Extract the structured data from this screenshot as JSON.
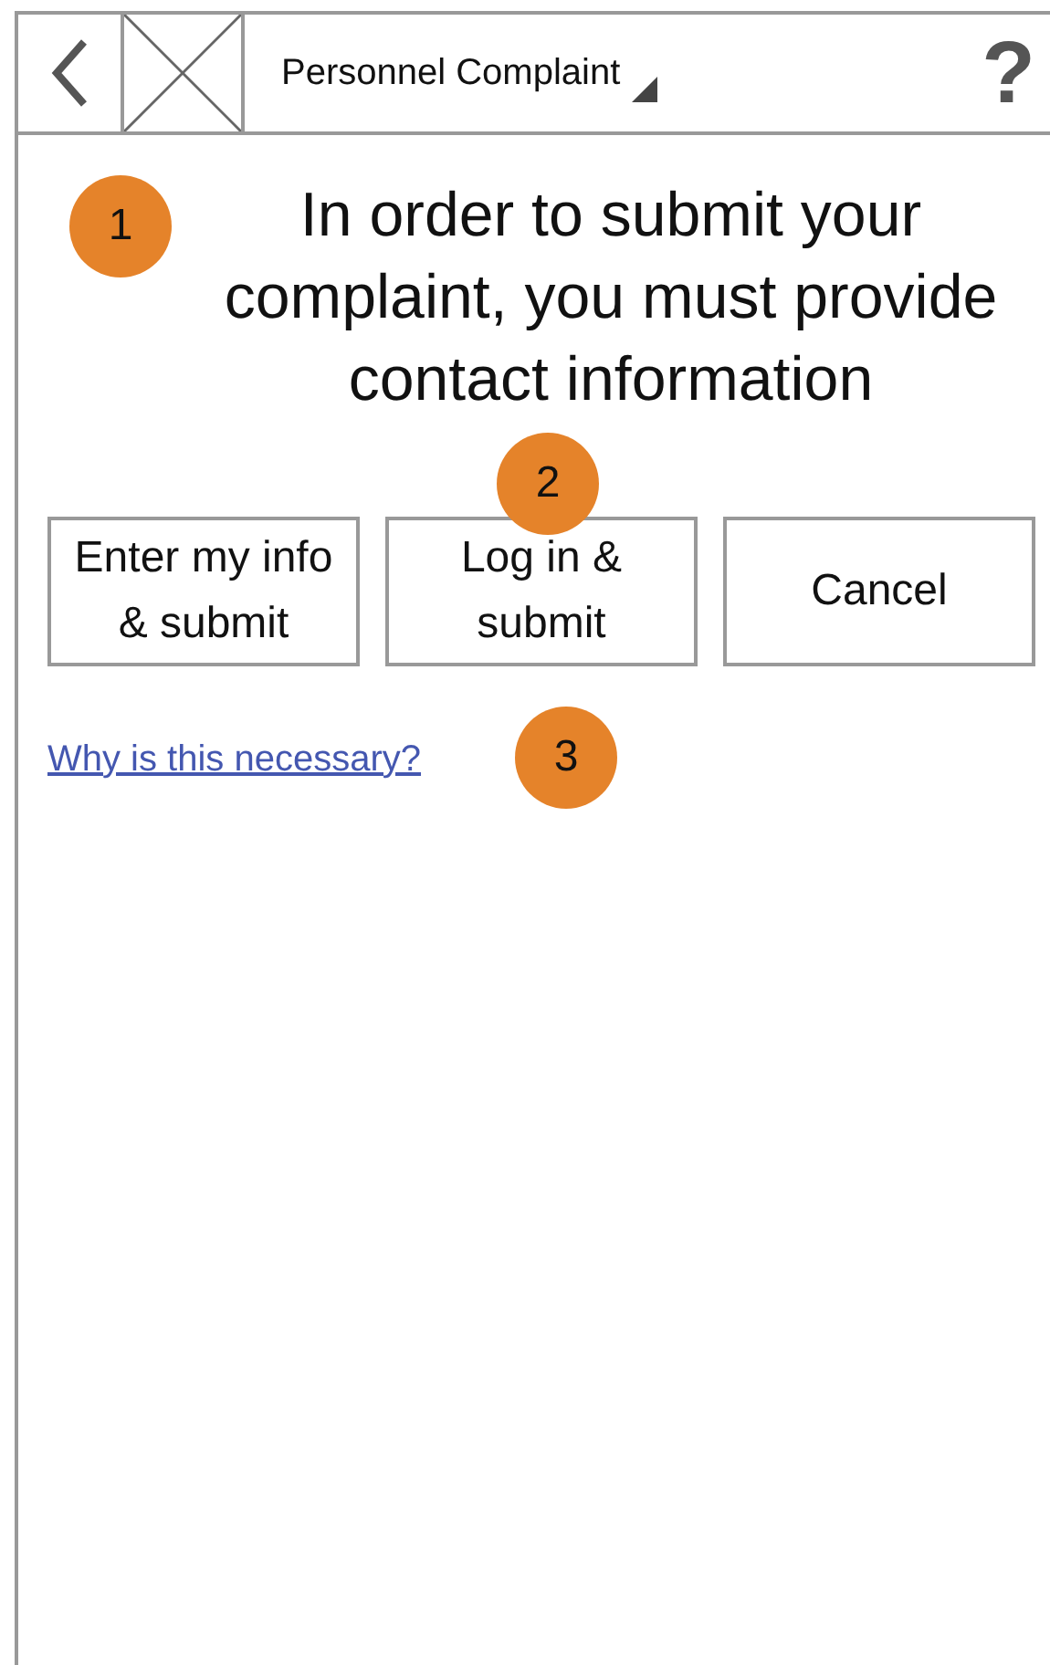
{
  "header": {
    "title": "Personnel Complaint",
    "help": "?"
  },
  "message": "In order to submit your complaint, you must provide contact information",
  "buttons": [
    {
      "label": "Enter my info & submit"
    },
    {
      "label": "Log in & submit"
    },
    {
      "label": "Cancel"
    }
  ],
  "link": "Why is this necessary?",
  "annotations": [
    {
      "number": "1"
    },
    {
      "number": "2"
    },
    {
      "number": "3"
    }
  ]
}
